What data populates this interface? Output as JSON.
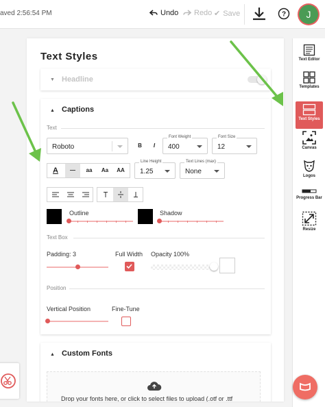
{
  "topbar": {
    "saved_text": "aved 2:56:54 PM",
    "undo_label": "Undo",
    "redo_label": "Redo",
    "save_label": "Save",
    "avatar_initial": "J"
  },
  "rail": {
    "items": [
      {
        "label": "Text Editor",
        "icon": "text-editor-icon"
      },
      {
        "label": "Templates",
        "icon": "templates-icon"
      },
      {
        "label": "Text Styles",
        "icon": "text-styles-icon",
        "active": true
      },
      {
        "label": "Canvas",
        "icon": "canvas-icon"
      },
      {
        "label": "Logos",
        "icon": "logos-icon"
      },
      {
        "label": "Progress Bar",
        "icon": "progress-bar-icon"
      },
      {
        "label": "Resize",
        "icon": "resize-icon"
      }
    ]
  },
  "panel": {
    "title": "Text Styles",
    "headline": {
      "label": "Headline"
    },
    "captions": {
      "title": "Captions",
      "text_section": "Text",
      "font": "Roboto",
      "bold_label": "B",
      "italic_label": "I",
      "font_weight_label": "Font Weight",
      "font_weight": "400",
      "font_size_label": "Font Size",
      "font_size": "12",
      "color_letter": "A",
      "case_options": [
        "—",
        "aa",
        "Aa",
        "AA"
      ],
      "line_height_label": "Line Height",
      "line_height": "1.25",
      "text_lines_label": "Text Lines (max)",
      "text_lines": "None",
      "outline_label": "Outline",
      "shadow_label": "Shadow",
      "text_box_section": "Text Box",
      "padding_label": "Padding: 3",
      "full_width_label": "Full Width",
      "opacity_label": "Opacity 100%",
      "position_section": "Position",
      "vertical_position_label": "Vertical Position",
      "fine_tune_label": "Fine-Tune"
    },
    "custom_fonts": {
      "title": "Custom Fonts",
      "drop_text": "Drop your fonts here, or click to select files to upload (.otf or .ttf"
    }
  },
  "colors": {
    "accent": "#e05a5a",
    "avatar": "#4a9b55",
    "arrow": "#6cc24a"
  }
}
